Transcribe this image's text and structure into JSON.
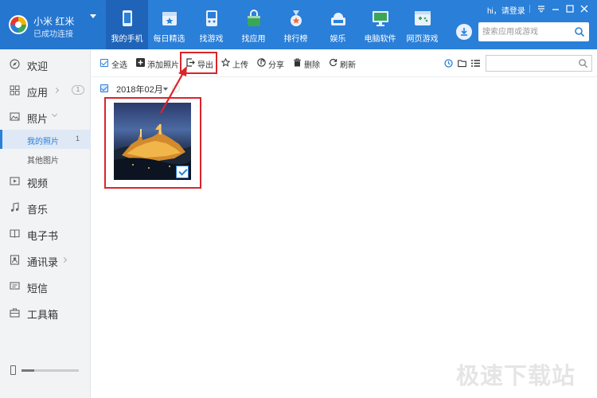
{
  "device": {
    "name": "小米 红米",
    "status": "已成功连接"
  },
  "nav": [
    {
      "label": "我的手机",
      "icon": "phone-icon",
      "active": true
    },
    {
      "label": "每日精选",
      "icon": "calendar-star-icon"
    },
    {
      "label": "找游戏",
      "icon": "gamepad-icon"
    },
    {
      "label": "找应用",
      "icon": "shopping-bag-icon"
    },
    {
      "label": "排行榜",
      "icon": "medal-icon"
    },
    {
      "label": "娱乐",
      "icon": "cloud-box-icon"
    },
    {
      "label": "电脑软件",
      "icon": "monitor-icon"
    },
    {
      "label": "网页游戏",
      "icon": "web-game-icon"
    }
  ],
  "header": {
    "login_text": "hi，请登录",
    "search_placeholder": "搜索应用或游戏"
  },
  "sidebar": {
    "items": [
      {
        "label": "欢迎",
        "icon": "compass-icon"
      },
      {
        "label": "应用",
        "icon": "grid-icon",
        "badge": "1"
      },
      {
        "label": "照片",
        "icon": "image-icon"
      },
      {
        "label": "视频",
        "icon": "video-icon"
      },
      {
        "label": "音乐",
        "icon": "music-icon"
      },
      {
        "label": "电子书",
        "icon": "book-icon"
      },
      {
        "label": "通讯录",
        "icon": "contacts-icon"
      },
      {
        "label": "短信",
        "icon": "message-icon"
      },
      {
        "label": "工具箱",
        "icon": "toolbox-icon"
      }
    ],
    "photo_sub": [
      {
        "label": "我的照片",
        "count": "1",
        "active": true
      },
      {
        "label": "其他图片"
      }
    ]
  },
  "toolbar": {
    "select_all": "全选",
    "add_photo": "添加照片",
    "export": "导出",
    "upload": "上传",
    "share": "分享",
    "delete": "删除",
    "refresh": "刷新",
    "search_placeholder": ""
  },
  "content": {
    "group_title": "2018年02月",
    "photos": [
      {
        "selected": true
      }
    ]
  },
  "colors": {
    "header_bg": "#2a7fd8",
    "active_nav": "#1f64b8",
    "sidebar_bg": "#f2f3f5",
    "highlight": "#d9252b"
  },
  "watermark": "极速下载站"
}
